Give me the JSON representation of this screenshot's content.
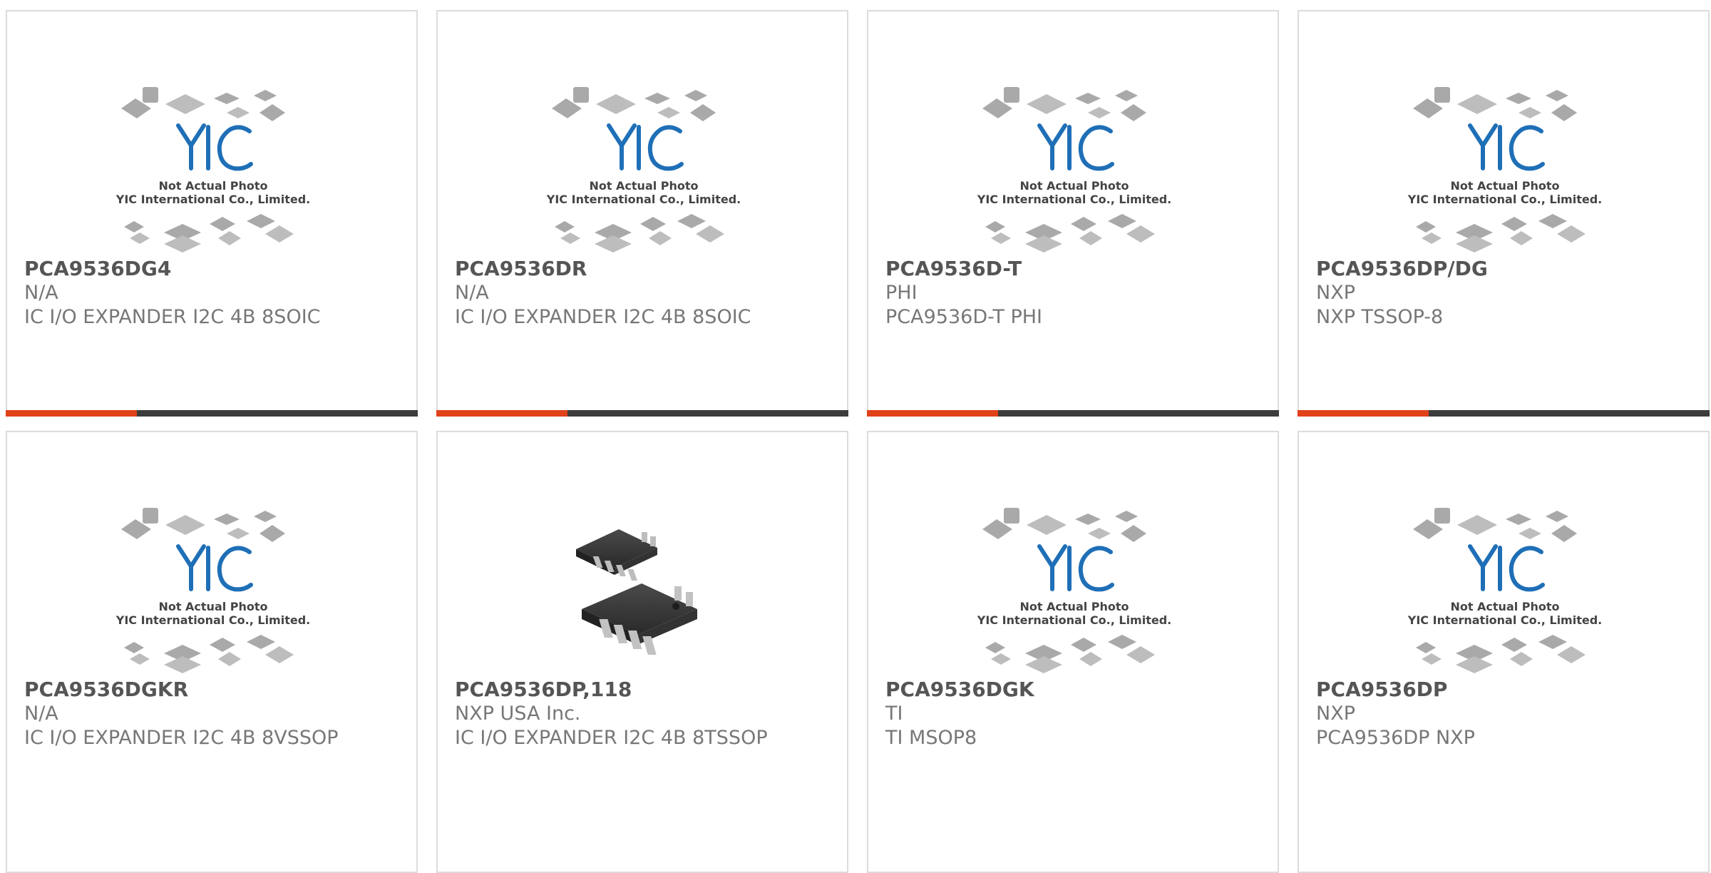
{
  "placeholder": {
    "line1": "Not Actual Photo",
    "line2": "YIC International Co., Limited."
  },
  "products": [
    {
      "part_number": "PCA9536DG4",
      "manufacturer": "N/A",
      "description": "IC I/O EXPANDER I2C 4B 8SOIC",
      "image": "placeholder"
    },
    {
      "part_number": "PCA9536DR",
      "manufacturer": "N/A",
      "description": "IC I/O EXPANDER I2C 4B 8SOIC",
      "image": "placeholder"
    },
    {
      "part_number": "PCA9536D-T",
      "manufacturer": "PHI",
      "description": "PCA9536D-T PHI",
      "image": "placeholder"
    },
    {
      "part_number": "PCA9536DP/DG",
      "manufacturer": "NXP",
      "description": "NXP TSSOP-8",
      "image": "placeholder"
    },
    {
      "part_number": "PCA9536DGKR",
      "manufacturer": "N/A",
      "description": "IC I/O EXPANDER I2C 4B 8VSSOP",
      "image": "placeholder"
    },
    {
      "part_number": "PCA9536DP,118",
      "manufacturer": "NXP USA Inc.",
      "description": "IC I/O EXPANDER I2C 4B 8TSSOP",
      "image": "chip-photo"
    },
    {
      "part_number": "PCA9536DGK",
      "manufacturer": "TI",
      "description": "TI MSOP8",
      "image": "placeholder"
    },
    {
      "part_number": "PCA9536DP",
      "manufacturer": "NXP",
      "description": "PCA9536DP NXP",
      "image": "placeholder"
    }
  ],
  "colors": {
    "accent": "#e0411a",
    "bar": "#3c3c3c",
    "logo": "#1f6fb7"
  }
}
